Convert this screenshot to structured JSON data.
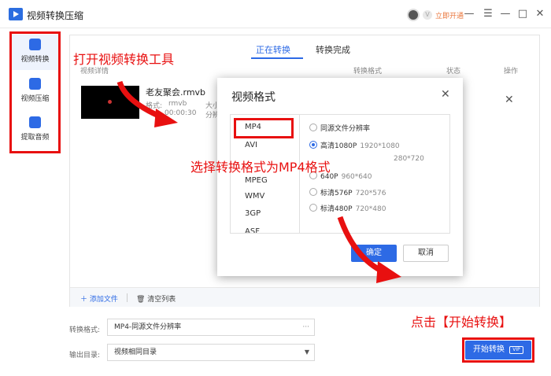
{
  "window": {
    "title": "视频转换压缩",
    "open_vip": "立即开通",
    "minimize": "—",
    "menu": "☰",
    "maximize": "□",
    "close": "✕"
  },
  "sidebar": {
    "items": [
      {
        "label": "视频转换"
      },
      {
        "label": "视频压缩"
      },
      {
        "label": "提取音频"
      }
    ]
  },
  "tabs": [
    {
      "label": "正在转换"
    },
    {
      "label": "转换完成"
    }
  ],
  "columns": {
    "detail": "视频详情",
    "format": "转换格式",
    "status": "状态",
    "action": "操作"
  },
  "file": {
    "name": "老友聚会.rmvb",
    "format_label": "格式:",
    "format": "rmvb",
    "size_label": "大小",
    "duration": "00:00:30",
    "res_label": "分辨"
  },
  "bottom": {
    "add_file": "添加文件",
    "clear_list": "清空列表"
  },
  "settings": {
    "format_label": "转换格式:",
    "format_value": "MP4-同源文件分辨率",
    "output_label": "输出目录:",
    "output_value": "视频相同目录"
  },
  "start_button": {
    "label": "开始转换",
    "vip": "VIP"
  },
  "dialog": {
    "title": "视频格式",
    "formats": [
      "MP4",
      "AVI",
      "MPEG",
      "WMV",
      "3GP",
      "ASF"
    ],
    "resolutions": [
      {
        "label": "同源文件分辨率",
        "dim": ""
      },
      {
        "label": "高清1080P",
        "dim": "1920*1080"
      },
      {
        "label": "",
        "dim": "280*720"
      },
      {
        "label": "640P",
        "dim": "960*640"
      },
      {
        "label": "标清576P",
        "dim": "720*576"
      },
      {
        "label": "标清480P",
        "dim": "720*480"
      }
    ],
    "ok": "确定",
    "cancel": "取消"
  },
  "annotations": {
    "step1": "打开视频转换工具",
    "step2": "选择转换格式为MP4格式",
    "step3": "点击【开始转换】"
  },
  "colors": {
    "accent": "#2d6ae5",
    "annotation": "#e81010"
  }
}
